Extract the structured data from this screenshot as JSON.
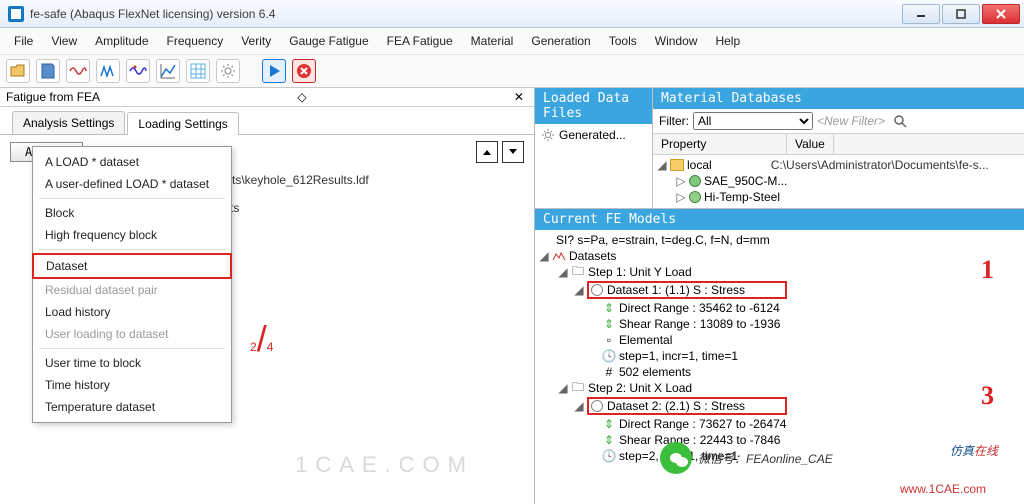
{
  "window": {
    "title": "fe-safe (Abaqus FlexNet licensing) version 6.4"
  },
  "menus": [
    "File",
    "View",
    "Amplitude",
    "Frequency",
    "Verity",
    "Gauge Fatigue",
    "FEA Fatigue",
    "Material",
    "Generation",
    "Tools",
    "Window",
    "Help"
  ],
  "left": {
    "pane_title": "Fatigue from FEA",
    "tab1": "Analysis Settings",
    "tab2": "Loading Settings",
    "add": "Add...",
    "bgtext1": "esults\\keyhole_612Results.ldf",
    "bgtext2": "peats"
  },
  "popup": {
    "items": [
      {
        "label": "A LOAD * dataset",
        "dis": false
      },
      {
        "label": "A user-defined LOAD * dataset",
        "dis": false
      },
      {
        "label": "Block",
        "dis": false,
        "sep_before": true
      },
      {
        "label": "High frequency block",
        "dis": false
      },
      {
        "label": "Dataset",
        "dis": false,
        "sel": true,
        "sep_before": true
      },
      {
        "label": "Residual dataset pair",
        "dis": true
      },
      {
        "label": "Load history",
        "dis": false
      },
      {
        "label": "User loading to dataset",
        "dis": true
      },
      {
        "label": "User time to block",
        "dis": false,
        "sep_before": true
      },
      {
        "label": "Time history",
        "dis": false
      },
      {
        "label": "Temperature dataset",
        "dis": false
      }
    ]
  },
  "right": {
    "loaded_hdr": "Loaded Data Files",
    "loaded_item": "Generated...",
    "matdb_hdr": "Material Databases",
    "filter_label": "Filter:",
    "filter_value": "All",
    "new_filter": "<New Filter>",
    "col_prop": "Property",
    "col_val": "Value",
    "local": "local",
    "localpath": "C:\\Users\\Administrator\\Documents\\fe-s...",
    "mat1": "SAE_950C-M...",
    "mat2": "Hi-Temp-Steel",
    "fem_hdr": "Current FE Models",
    "units": "SI?  s=Pa, e=strain, t=deg.C, f=N, d=mm",
    "datasets": "Datasets",
    "step1": "Step 1: Unit Y Load",
    "ds1": "Dataset 1: (1.1) S :   Stress",
    "ds1_dir": "Direct Range : 35462 to -6124",
    "ds1_shear": "Shear Range : 13089 to -1936",
    "ds1_elem": "Elemental",
    "ds1_step": "step=1, incr=1, time=1",
    "ds1_count": "502 elements",
    "step2": "Step 2: Unit X Load",
    "ds2": "Dataset 2: (2.1) S :   Stress",
    "ds2_dir": "Direct Range : 73627 to -26474",
    "ds2_shear": "Shear Range : 22443 to -7846",
    "ds2_step": "step=2, incr=1, time=1"
  },
  "annot": {
    "n2": "2",
    "n4": "4",
    "n1": "1",
    "n3": "3",
    "slash": "/"
  },
  "wm": {
    "cae": "1CAE.COM",
    "url": "www.1CAE.com",
    "cn1": "仿真",
    "cn2": "在线",
    "wechat": "微信号：FEAonline_CAE"
  }
}
